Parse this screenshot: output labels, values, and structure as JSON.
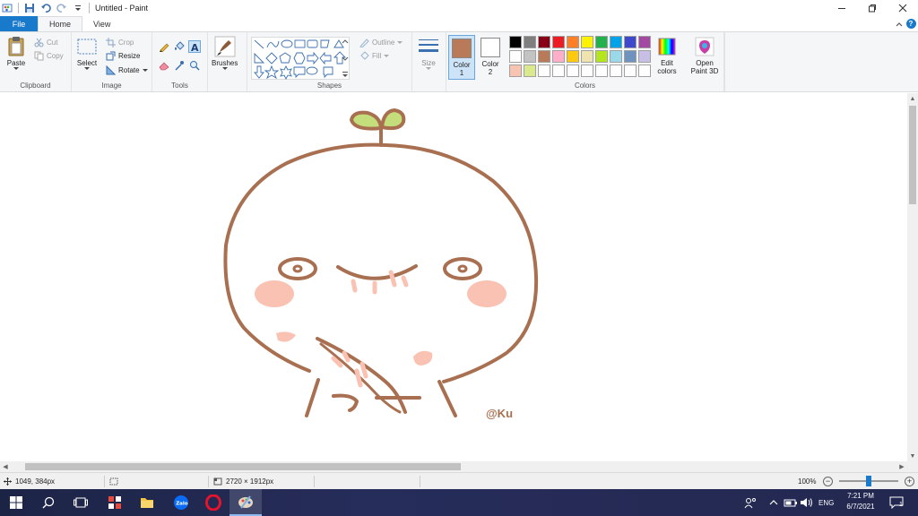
{
  "window": {
    "title": "Untitled - Paint"
  },
  "tabs": [
    {
      "label": "File"
    },
    {
      "label": "Home"
    },
    {
      "label": "View"
    }
  ],
  "ribbon": {
    "clipboard": {
      "group": "Clipboard",
      "paste": "Paste",
      "cut": "Cut",
      "copy": "Copy"
    },
    "image": {
      "group": "Image",
      "select": "Select",
      "crop": "Crop",
      "resize": "Resize",
      "rotate": "Rotate"
    },
    "tools": {
      "group": "Tools"
    },
    "brushes": {
      "label": "Brushes"
    },
    "shapes": {
      "group": "Shapes",
      "outline": "Outline",
      "fill": "Fill"
    },
    "size": {
      "label": "Size"
    },
    "colors": {
      "group": "Colors",
      "color1_label": "Color",
      "color1_num": "1",
      "color2_label": "Color",
      "color2_num": "2",
      "color1_value": "#b87a58",
      "color2_value": "#ffffff",
      "edit_colors": "Edit",
      "edit_colors2": "colors",
      "palette": [
        "#000000",
        "#7f7f7f",
        "#880015",
        "#ed1c24",
        "#ff7f27",
        "#fff200",
        "#22b14c",
        "#00a2e8",
        "#3f48cc",
        "#a349a4",
        "#ffffff",
        "#c3c3c3",
        "#b97a57",
        "#ffaec9",
        "#ffc90e",
        "#efe4b0",
        "#b5e61d",
        "#99d9ea",
        "#7092be",
        "#c8bfe7",
        "#f8c3b0",
        "#d9e98c",
        "#ffffff",
        "#ffffff",
        "#ffffff",
        "#ffffff",
        "#ffffff",
        "#ffffff",
        "#ffffff",
        "#ffffff"
      ]
    },
    "paint3d": {
      "label1": "Open",
      "label2": "Paint 3D"
    }
  },
  "canvas": {
    "signature": "@Ku",
    "stroke_color": "#a86f50",
    "blush_color": "#f9c2b2",
    "leaf_color": "#c3de7a"
  },
  "status": {
    "cursor_pos": "1049, 384px",
    "canvas_size": "2720 × 1912px",
    "zoom": "100%"
  },
  "taskbar": {
    "language": "ENG",
    "time": "7:21 PM",
    "date": "6/7/2021",
    "notifications": "1"
  }
}
